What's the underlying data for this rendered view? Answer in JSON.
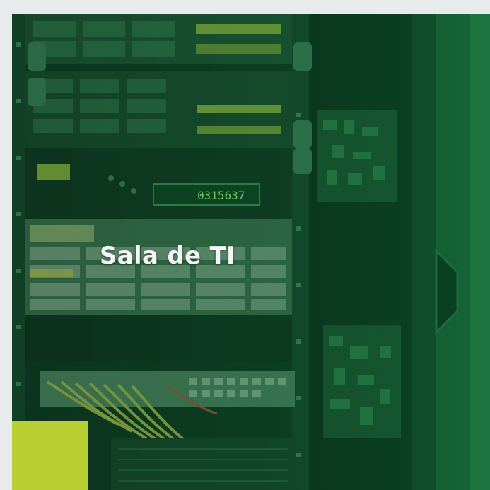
{
  "card": {
    "title": "Sala de TI",
    "image_subject": "server-rack-photo"
  },
  "colors": {
    "background": "#e8ebec",
    "overlay_tint": "#0b5a2d",
    "accent_block": "#b8d031",
    "title_text": "#f3f6f4",
    "display_text": "#9cff7a"
  },
  "equipment": {
    "display_readout": "0315637"
  }
}
